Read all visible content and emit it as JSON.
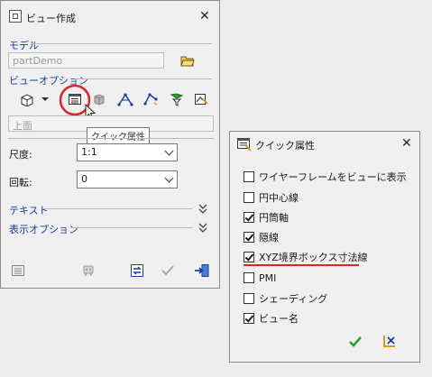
{
  "view_dialog": {
    "title": "ビュー作成",
    "model_section": "モデル",
    "model_value": "partDemo",
    "view_options_section": "ビューオプション",
    "view_name_value": "上面",
    "scale_label": "尺度:",
    "scale_value": "1:1",
    "rotation_label": "回転:",
    "rotation_value": "0",
    "text_section": "テキスト",
    "display_options_section": "表示オプション",
    "tooltip": "クイック属性",
    "highlight_color": "#d62828"
  },
  "quick_attr_dialog": {
    "title": "クイック属性",
    "items": [
      {
        "label": "ワイヤーフレームをビューに表示",
        "checked": false
      },
      {
        "label": "円中心線",
        "checked": false
      },
      {
        "label": "円筒軸",
        "checked": true
      },
      {
        "label": "隠線",
        "checked": true
      },
      {
        "label": "XYZ境界ボックス寸法線",
        "checked": true
      },
      {
        "label": "PMI",
        "checked": false
      },
      {
        "label": "シェーディング",
        "checked": false
      },
      {
        "label": "ビュー名",
        "checked": true
      }
    ],
    "underline_color": "#d62828",
    "ok_color": "#2a9d2a"
  }
}
